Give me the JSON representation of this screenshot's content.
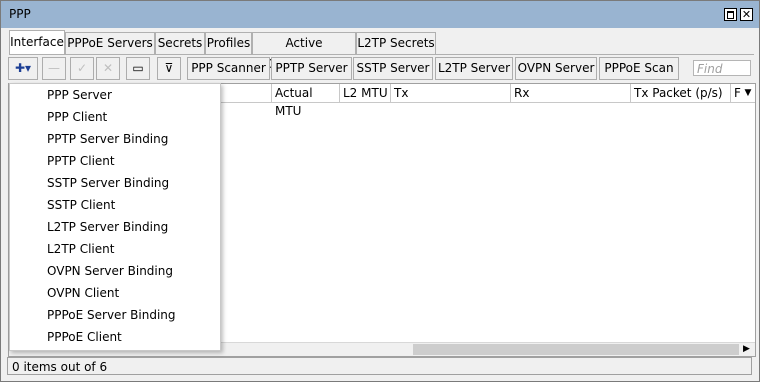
{
  "window": {
    "title": "PPP",
    "maximize_icon": "maximize-icon",
    "close_icon": "close-icon",
    "close_glyph": "✕"
  },
  "tabs": [
    "Interface",
    "PPPoE Servers",
    "Secrets",
    "Profiles",
    "Active Connections",
    "L2TP Secrets"
  ],
  "toolbar": {
    "add_glyph": "✚▾",
    "remove_glyph": "—",
    "enable_glyph": "✓",
    "disable_glyph": "✕",
    "comment_glyph": "▭",
    "filter_glyph": "⊽",
    "buttons": [
      "PPP Scanner",
      "PPTP Server",
      "SSTP Server",
      "L2TP Server",
      "OVPN Server",
      "PPPoE Scan"
    ],
    "find_placeholder": "Find"
  },
  "table": {
    "columns": [
      "Actual MTU",
      "L2 MTU",
      "Tx",
      "Rx",
      "Tx Packet (p/s)",
      "F"
    ],
    "dropdown_arrow": "▼",
    "scroll_right_glyph": "▶"
  },
  "status": {
    "text": "0 items out of 6"
  },
  "add_menu": {
    "items": [
      "PPP Server",
      "PPP Client",
      "PPTP Server Binding",
      "PPTP Client",
      "SSTP Server Binding",
      "SSTP Client",
      "L2TP Server Binding",
      "L2TP Client",
      "OVPN Server Binding",
      "OVPN Client",
      "PPPoE Server Binding",
      "PPPoE Client"
    ]
  },
  "colors": {
    "titlebar": "#99b4d1",
    "add_icon": "#1d3f95"
  }
}
